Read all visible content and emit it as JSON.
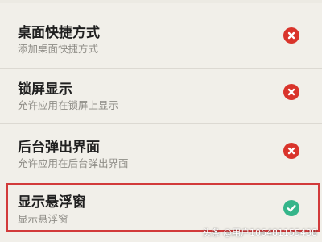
{
  "colors": {
    "background": "#f1efe9",
    "denied": "#d9342b",
    "allowed": "#35b58a",
    "highlight_border": "#d23a3a"
  },
  "settings": [
    {
      "title": "桌面快捷方式",
      "subtitle": "添加桌面快捷方式",
      "status_icon": "x-circle-icon"
    },
    {
      "title": "锁屏显示",
      "subtitle": "允许应用在锁屏上显示",
      "status_icon": "x-circle-icon"
    },
    {
      "title": "后台弹出界面",
      "subtitle": "允许应用在后台弹出界面",
      "status_icon": "x-circle-icon"
    },
    {
      "title": "显示悬浮窗",
      "subtitle": "显示悬浮窗",
      "status_icon": "check-circle-icon"
    }
  ],
  "watermark": "头条 @用户106481155438"
}
